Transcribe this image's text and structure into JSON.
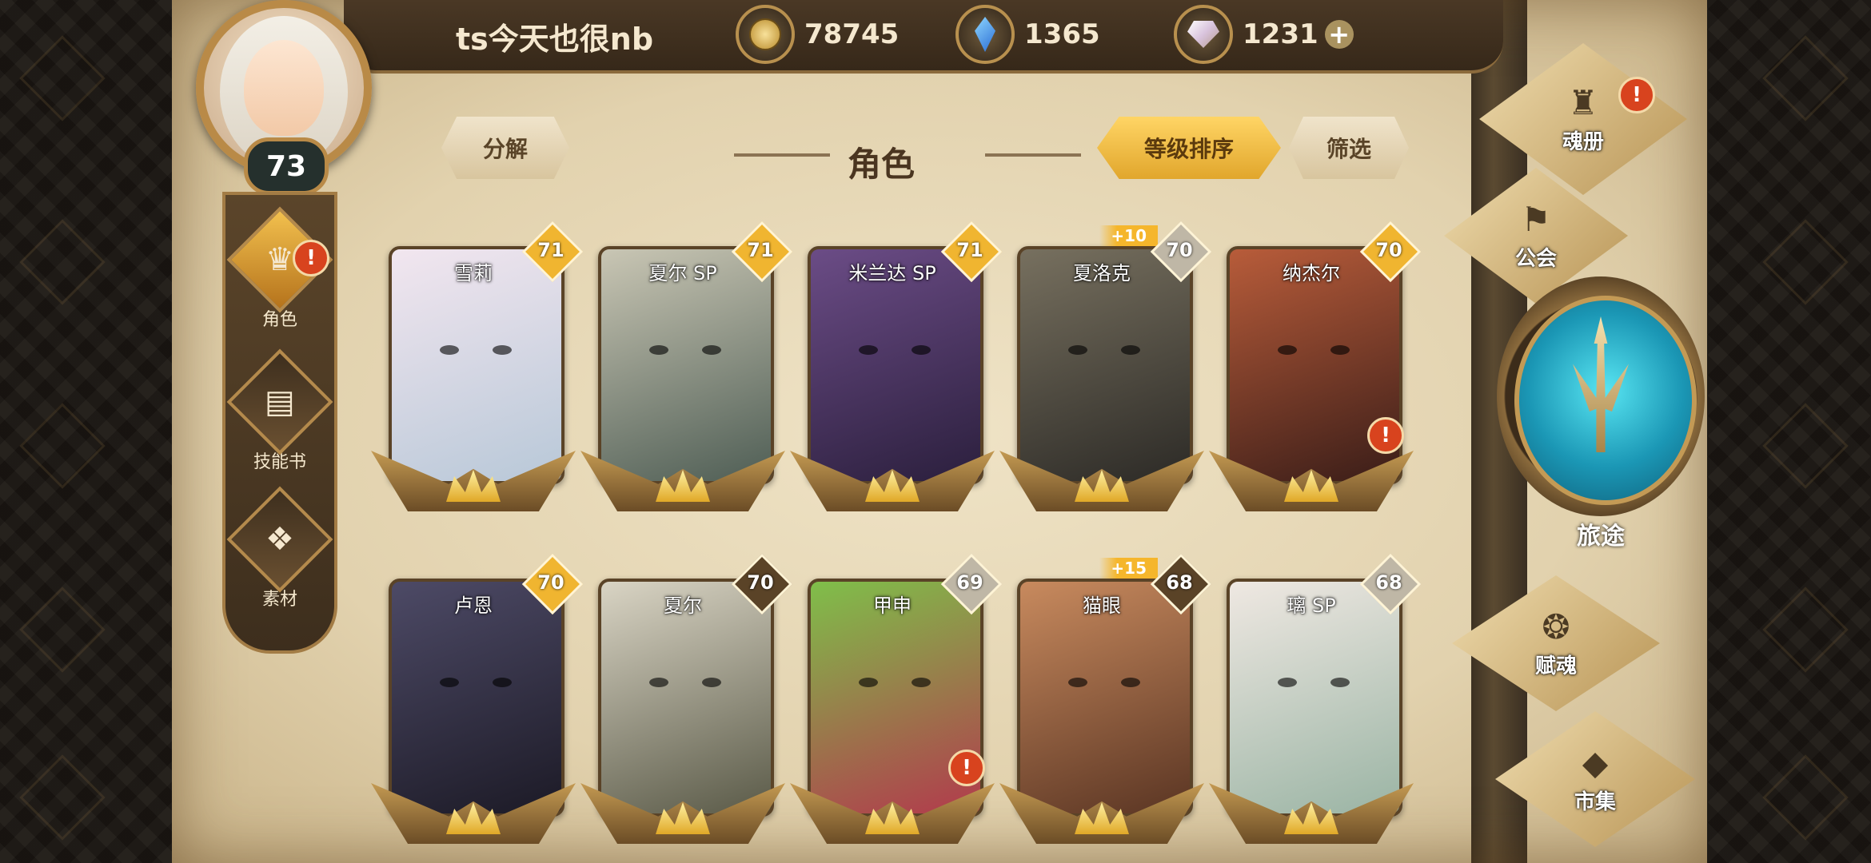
{
  "player": {
    "name": "ts今天也很nb",
    "level": "73"
  },
  "currencies": [
    {
      "icon": "gold-coin-icon",
      "value": "78745"
    },
    {
      "icon": "blue-crystal-icon",
      "value": "1365"
    },
    {
      "icon": "soul-gem-icon",
      "value": "1231",
      "plus": "+"
    }
  ],
  "left_nav": [
    {
      "label": "角色",
      "icon": "helmet-icon",
      "active": true,
      "alert": "!"
    },
    {
      "label": "技能书",
      "icon": "book-icon",
      "active": false
    },
    {
      "label": "素材",
      "icon": "beast-icon",
      "active": false
    }
  ],
  "header": {
    "title": "角色",
    "decompose_label": "分解",
    "sort_label": "等级排序",
    "filter_label": "筛选"
  },
  "characters": [
    {
      "name": "雪莉",
      "level": "71",
      "rarity_color": "#f0b530",
      "alert": false,
      "plus": "",
      "palette": [
        "#f2e6ef",
        "#b8c8d8"
      ]
    },
    {
      "name": "夏尔 SP",
      "level": "71",
      "rarity_color": "#f0b530",
      "alert": false,
      "plus": "",
      "palette": [
        "#c9c6b4",
        "#4f5e55"
      ]
    },
    {
      "name": "米兰达 SP",
      "level": "71",
      "rarity_color": "#f0b530",
      "alert": false,
      "plus": "",
      "palette": [
        "#6b4c86",
        "#2b1f3d"
      ]
    },
    {
      "name": "夏洛克",
      "level": "70",
      "rarity_color": "#bfb7a6",
      "alert": false,
      "plus": "+10",
      "palette": [
        "#77705f",
        "#2c2a26"
      ]
    },
    {
      "name": "纳杰尔",
      "level": "70",
      "rarity_color": "#f0b530",
      "alert": true,
      "plus": "",
      "palette": [
        "#b85c3a",
        "#3a1d18"
      ]
    },
    {
      "name": "卢恩",
      "level": "70",
      "rarity_color": "#f0b530",
      "alert": false,
      "plus": "",
      "palette": [
        "#4d4a66",
        "#1c1a26"
      ]
    },
    {
      "name": "夏尔",
      "level": "70",
      "rarity_color": "#5a4327",
      "alert": false,
      "plus": "",
      "palette": [
        "#d9d4c4",
        "#5a5a48"
      ]
    },
    {
      "name": "甲申",
      "level": "69",
      "rarity_color": "#bfb7a6",
      "alert": true,
      "plus": "",
      "palette": [
        "#7fbf4a",
        "#b23a4c"
      ]
    },
    {
      "name": "猫眼",
      "level": "68",
      "rarity_color": "#5a4327",
      "alert": false,
      "plus": "+15",
      "palette": [
        "#c88a5e",
        "#5a3523"
      ]
    },
    {
      "name": "璃 SP",
      "level": "68",
      "rarity_color": "#bfb7a6",
      "alert": false,
      "plus": "",
      "palette": [
        "#efe8e2",
        "#9ab4a4"
      ]
    }
  ],
  "right_nav": [
    {
      "label": "魂册",
      "icon": "soul-book-icon",
      "alert": "!"
    },
    {
      "label": "公会",
      "icon": "guild-banner-icon"
    },
    {
      "label": "旅途",
      "icon": "trident-icon"
    },
    {
      "label": "赋魂",
      "icon": "flame-swirl-icon"
    },
    {
      "label": "市集",
      "icon": "gem-icon"
    }
  ]
}
